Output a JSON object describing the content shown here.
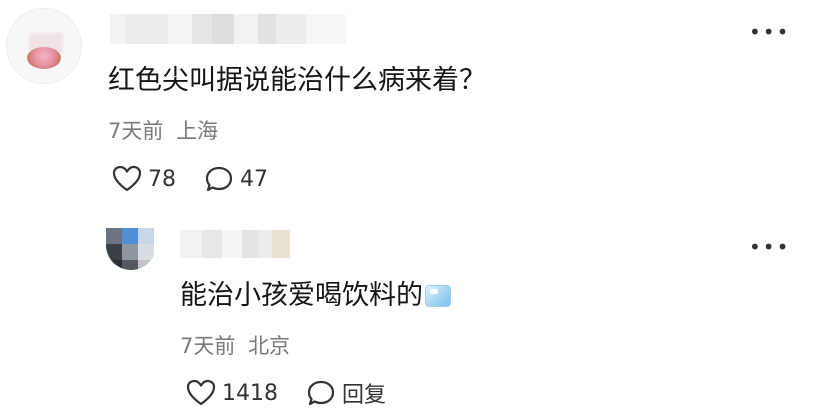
{
  "comments": [
    {
      "text": "红色尖叫据说能治什么病来着？",
      "time": "7天前",
      "location": "上海",
      "likes": "78",
      "replies": "47"
    }
  ],
  "reply": {
    "text": "能治小孩爱喝饮料的",
    "emoji": "ice-cube-emoji",
    "time": "7天前",
    "location": "北京",
    "likes": "1418",
    "reply_label": "回复"
  },
  "icons": {
    "like": "heart-outline-icon",
    "comment": "speech-bubble-icon",
    "more": "more-dots-icon"
  },
  "colors": {
    "text": "#151515",
    "meta": "#7a7a7a",
    "icon": "#333333"
  }
}
